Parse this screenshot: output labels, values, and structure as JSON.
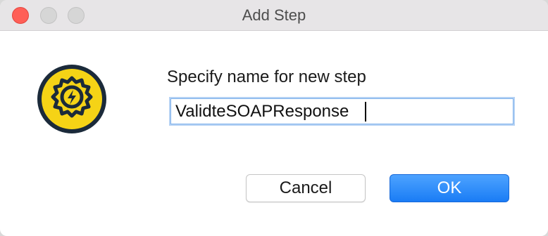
{
  "window": {
    "title": "Add Step",
    "controls": [
      "close",
      "minimize",
      "maximize"
    ]
  },
  "dialog": {
    "icon": "soapui-gear-lightning-icon",
    "prompt": "Specify name for new step",
    "name_field": {
      "value": "ValidteSOAPResponse"
    }
  },
  "buttons": {
    "cancel_label": "Cancel",
    "ok_label": "OK"
  },
  "colors": {
    "accent": "#1a7cf5",
    "icon_yellow": "#f5d316",
    "icon_dark": "#1b2a3a"
  }
}
